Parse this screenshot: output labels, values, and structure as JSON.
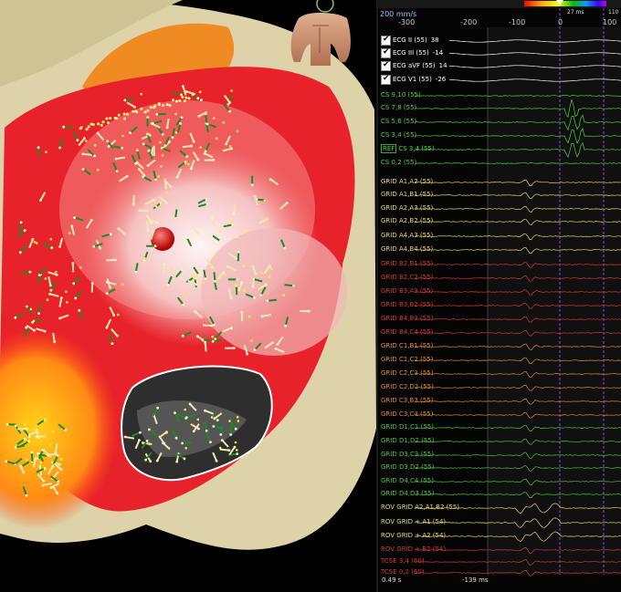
{
  "speed_label": "200 mm/s",
  "time_ticks": [
    "-300",
    "-200",
    "-100",
    "0",
    "100"
  ],
  "ms_readout": "27 ms",
  "top_right_value": "110",
  "footer": {
    "left": "0.49 s",
    "mid": "-139 ms"
  },
  "colors": {
    "ecg": "#ffffff",
    "cs": "#4cd43a",
    "grid_a": "#e8d36a",
    "grid_b": "#d23a2e",
    "grid_c": "#e08a2a",
    "grid_d": "#4cc63a",
    "rov": "#e8d36a",
    "tcse": "#d23a2e",
    "marker": "#b450ff"
  },
  "channels": [
    {
      "label": "ECG II (55)",
      "value": "38",
      "group": "ecg",
      "checked": true
    },
    {
      "label": "ECG III (55)",
      "value": "-14",
      "group": "ecg",
      "checked": true
    },
    {
      "label": "ECG aVF (55)",
      "value": "14",
      "group": "ecg",
      "checked": true
    },
    {
      "label": "ECG V1 (55)",
      "value": "-26",
      "group": "ecg",
      "checked": true
    },
    {
      "label": "CS 9,10 (55)",
      "group": "cs"
    },
    {
      "label": "CS 7,8 (55)",
      "group": "cs"
    },
    {
      "label": "CS 5,6 (55)",
      "group": "cs"
    },
    {
      "label": "CS 3,4 (55)",
      "group": "cs"
    },
    {
      "label": "CS 3,4 (55)",
      "group": "cs",
      "ref": "REF"
    },
    {
      "label": "CS 0,2 (55)",
      "group": "cs"
    },
    {
      "label": "GRID A1,A2 (55)",
      "group": "grid_a"
    },
    {
      "label": "GRID A1,B1 (55)",
      "group": "grid_a"
    },
    {
      "label": "GRID A2,A3 (55)",
      "group": "grid_a"
    },
    {
      "label": "GRID A2,B2 (55)",
      "group": "grid_a"
    },
    {
      "label": "GRID A4,A3 (55)",
      "group": "grid_a"
    },
    {
      "label": "GRID A4,B4 (55)",
      "group": "grid_a"
    },
    {
      "label": "GRID B2,B1 (55)",
      "group": "grid_b"
    },
    {
      "label": "GRID B2,C2 (55)",
      "group": "grid_b"
    },
    {
      "label": "GRID B3,A3 (55)",
      "group": "grid_b"
    },
    {
      "label": "GRID B3,B2 (55)",
      "group": "grid_b"
    },
    {
      "label": "GRID B4,B3 (55)",
      "group": "grid_b"
    },
    {
      "label": "GRID B4,C4 (55)",
      "group": "grid_b"
    },
    {
      "label": "GRID C1,B1 (55)",
      "group": "grid_c"
    },
    {
      "label": "GRID C1,C2 (55)",
      "group": "grid_c"
    },
    {
      "label": "GRID C2,C3 (55)",
      "group": "grid_c"
    },
    {
      "label": "GRID C2,D2 (55)",
      "group": "grid_c"
    },
    {
      "label": "GRID C3,B3 (55)",
      "group": "grid_c"
    },
    {
      "label": "GRID C3,C4 (55)",
      "group": "grid_c"
    },
    {
      "label": "GRID D1,C1 (55)",
      "group": "grid_d"
    },
    {
      "label": "GRID D1,D2 (55)",
      "group": "grid_d"
    },
    {
      "label": "GRID D3,C3 (55)",
      "group": "grid_d"
    },
    {
      "label": "GRID D3,D2 (55)",
      "group": "grid_d"
    },
    {
      "label": "GRID D4,C4 (55)",
      "group": "grid_d"
    },
    {
      "label": "GRID D4,D3 (55)",
      "group": "grid_d"
    },
    {
      "label": "ROV GRID   A2,A1,B2 (55)",
      "group": "rov"
    },
    {
      "label": "ROV GRID + A1 (54)",
      "group": "rov"
    },
    {
      "label": "ROV GRID + A2 (54)",
      "group": "rov"
    },
    {
      "label": "ROV GRID + B2 (54)",
      "group": "tcse"
    },
    {
      "label": "TCSE 3,4 (60)",
      "group": "tcse"
    },
    {
      "label": "TCSE 0,2 (60)",
      "group": "tcse"
    }
  ]
}
